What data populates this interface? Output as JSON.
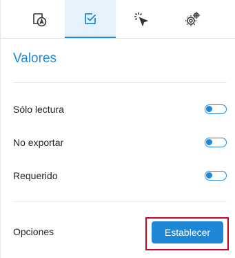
{
  "tabs": [
    {
      "icon": "text-field-icon",
      "active": false
    },
    {
      "icon": "checkbox-icon",
      "active": true
    },
    {
      "icon": "cursor-click-icon",
      "active": false
    },
    {
      "icon": "settings-gears-icon",
      "active": false
    }
  ],
  "section": {
    "title": "Valores"
  },
  "properties": [
    {
      "label": "Sólo lectura",
      "enabled": false
    },
    {
      "label": "No exportar",
      "enabled": false
    },
    {
      "label": "Requerido",
      "enabled": false
    }
  ],
  "options": {
    "label": "Opciones",
    "button_label": "Establecer"
  },
  "colors": {
    "accent": "#1e88d6",
    "active_tab_bg": "#e5f1fb",
    "highlight": "#d0021b"
  }
}
